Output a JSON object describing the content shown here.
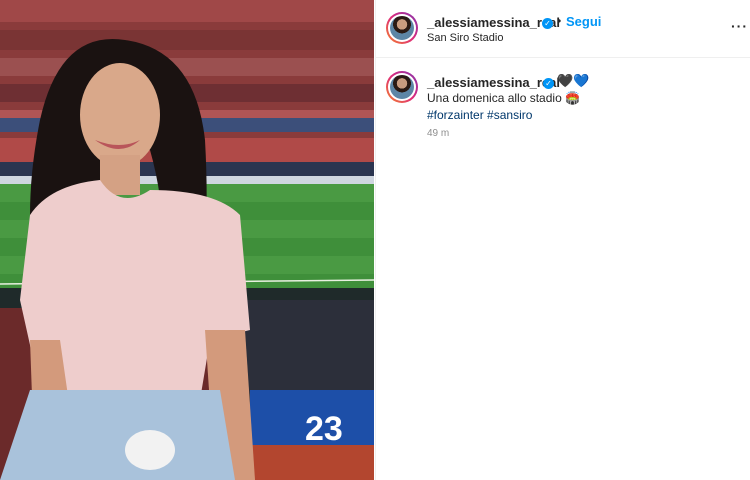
{
  "header": {
    "username": "_alessiamessina_real",
    "verified_mark": "✓",
    "separator": "•",
    "follow_label": "Segui",
    "location": "San Siro Stadio",
    "more_label": "···"
  },
  "caption": {
    "username": "_alessiamessina_real",
    "verified_mark": "✓",
    "emoji": "🖤💙",
    "text": "Una domenica allo stadio 🏟️",
    "hashtags": [
      "#forzainter",
      "#sansiro"
    ],
    "timestamp": "49 m"
  },
  "image": {
    "jersey_number": "23",
    "icons": [
      "verified-badge-icon",
      "more-options-icon",
      "black-heart-emoji",
      "blue-heart-emoji",
      "stadium-emoji"
    ]
  },
  "colors": {
    "link_blue": "#0095f6",
    "hashtag_blue": "#00376b",
    "text": "#262626",
    "muted": "#8e8e8e"
  }
}
